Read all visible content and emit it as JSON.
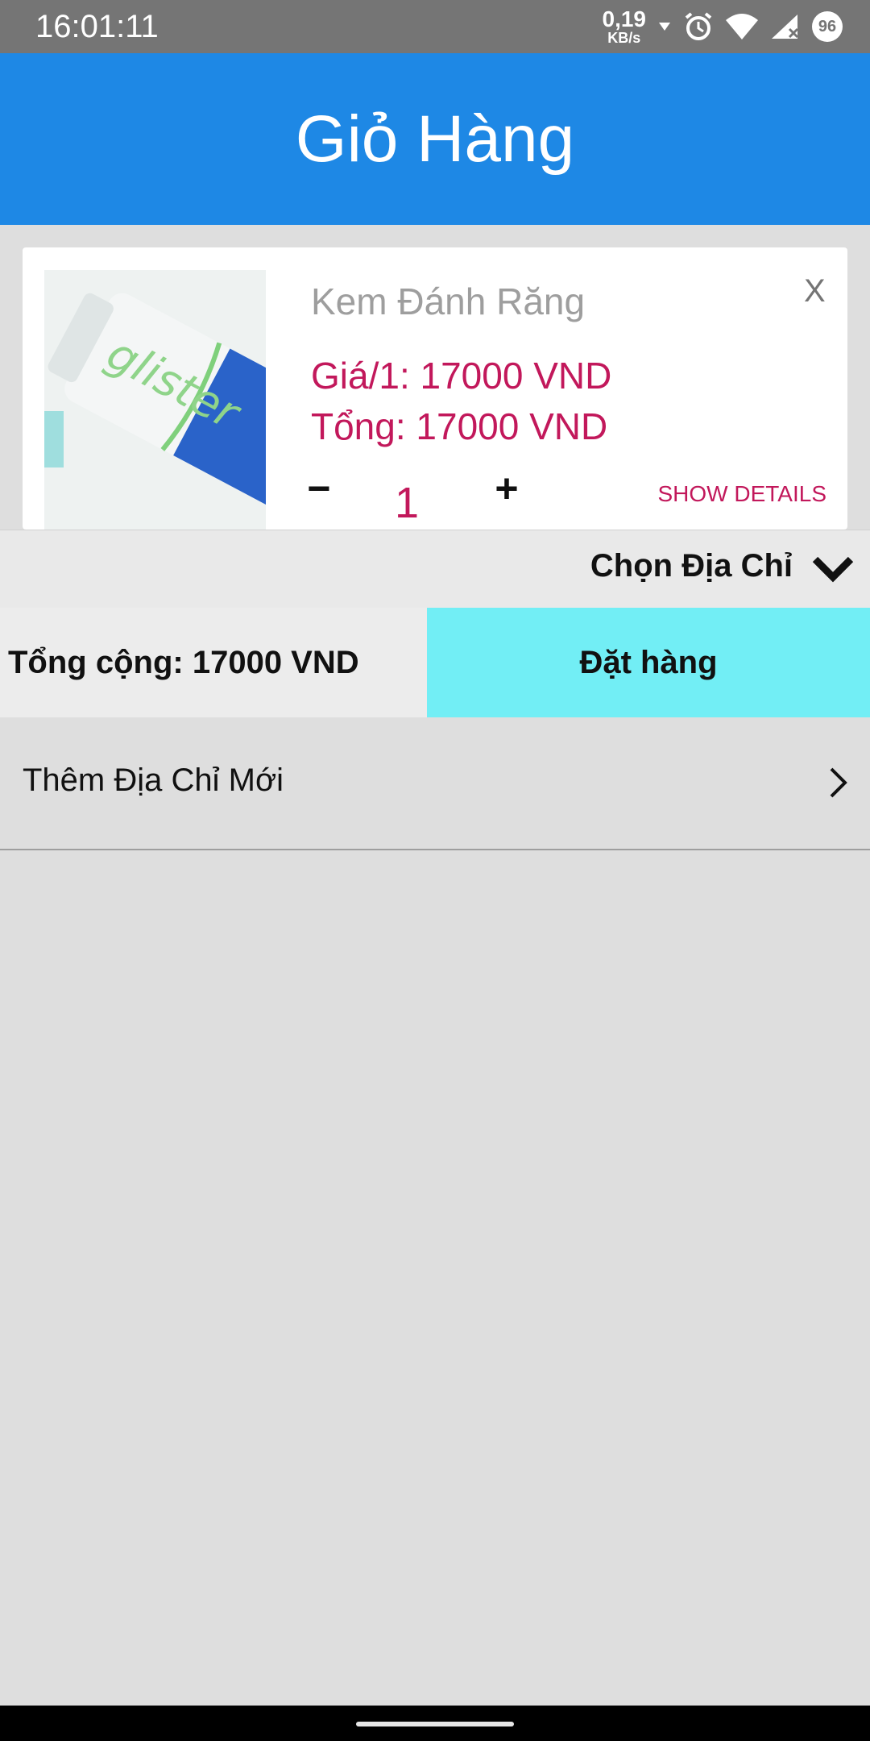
{
  "status_bar": {
    "time": "16:01:11",
    "net_speed_value": "0,19",
    "net_speed_unit": "KB/s",
    "battery_level": "96",
    "icons": [
      "download-arrow-icon",
      "alarm-icon",
      "wifi-icon",
      "signal-icon",
      "battery-icon"
    ]
  },
  "app_bar": {
    "title": "Giỏ Hàng"
  },
  "cart": {
    "items": [
      {
        "name": "Kem Đánh Răng",
        "unit_price": "Giá/1: 17000 VND",
        "total": "Tổng: 17000 VND",
        "quantity": "1",
        "remove_label": "X",
        "minus_label": "−",
        "plus_label": "+",
        "details_label": "SHOW DETAILS",
        "image_text": "glister"
      }
    ]
  },
  "address_selector": {
    "label": "Chọn Địa Chỉ",
    "icon": "chevron-down-icon"
  },
  "summary": {
    "total_label": "Tổng cộng: 17000 VND",
    "order_label": "Đặt hàng"
  },
  "add_address": {
    "label": "Thêm Địa Chỉ Mới",
    "icon": "chevron-right-icon"
  },
  "colors": {
    "app_bar": "#1e88e5",
    "accent": "#c2185b",
    "order_button": "#72eef5",
    "background": "#dedede"
  }
}
